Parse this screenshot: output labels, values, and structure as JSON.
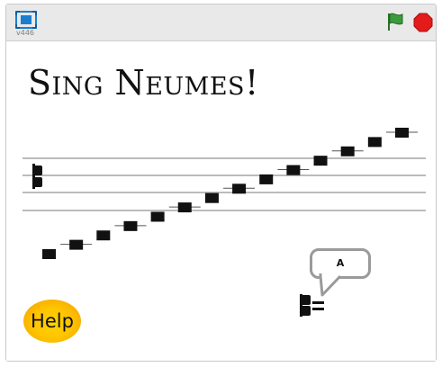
{
  "topbar": {
    "fullscreen_icon": "fullscreen-icon",
    "version": "v446",
    "green_flag_icon": "green-flag-icon",
    "stop_icon": "stop-icon",
    "colors": {
      "flag": "#2e8b2e",
      "stop": "#e31b1b",
      "fullscreen": "#1a7fd1"
    }
  },
  "stage": {
    "title": "Sing Neumes!",
    "clef_icon": "c-clef-icon",
    "note_count": 14,
    "speech_bubble_text": "A",
    "help_label": "Help"
  }
}
